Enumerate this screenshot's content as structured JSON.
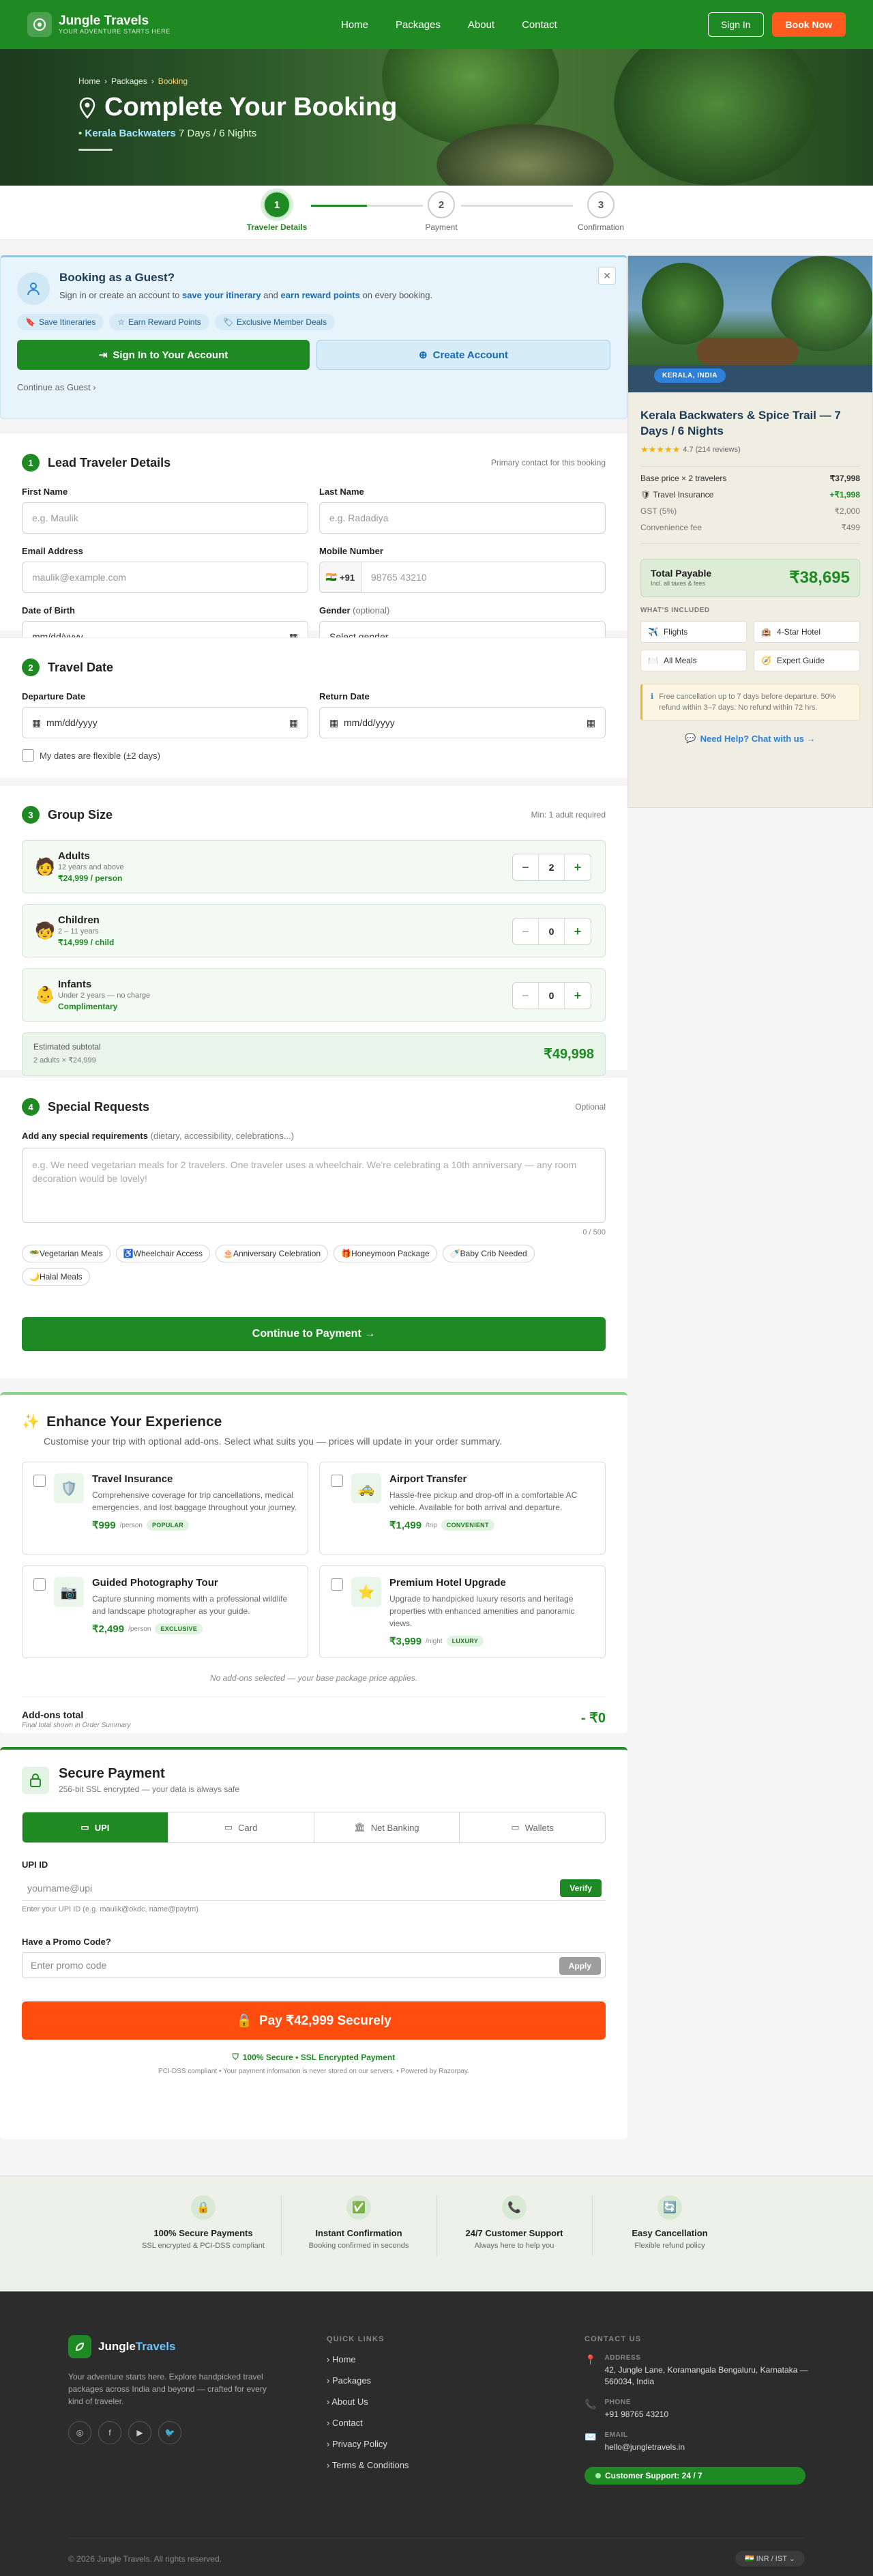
{
  "header": {
    "brand": "Jungle Travels",
    "tagline": "YOUR ADVENTURE STARTS HERE",
    "nav": [
      "Home",
      "Packages",
      "About",
      "Contact"
    ],
    "sign_in": "Sign In",
    "book_now": "Book Now"
  },
  "hero": {
    "crumbs": [
      "Home",
      "›",
      "Packages",
      "›",
      "Booking"
    ],
    "title": "Complete Your Booking",
    "package": "Kerala Backwaters",
    "duration": "7 Days / 6 Nights"
  },
  "steps": [
    {
      "num": "1",
      "label": "Traveler Details"
    },
    {
      "num": "2",
      "label": "Payment"
    },
    {
      "num": "3",
      "label": "Confirmation"
    }
  ],
  "guest": {
    "title": "Booking as a Guest?",
    "desc_a": "Sign in or create an account to",
    "desc_b": "save your itinerary",
    "desc_c": "and",
    "desc_d": "earn reward points",
    "desc_e": "on every booking.",
    "chips": [
      "Save Itineraries",
      "Earn Reward Points",
      "Exclusive Member Deals"
    ],
    "signin": "Sign In to Your Account",
    "create": "Create Account",
    "continue": "Continue as Guest  ›",
    "close": "✕"
  },
  "lead": {
    "num": "1",
    "title": "Lead Traveler Details",
    "note": "Primary contact for this booking",
    "first_label": "First Name",
    "first_ph": "e.g. Maulik",
    "last_label": "Last Name",
    "last_ph": "e.g. Radadiya",
    "email_label": "Email Address",
    "email_ph": "maulik@example.com",
    "mobile_label": "Mobile Number",
    "code": "+91",
    "mobile_ph": "98765 43210",
    "dob_label": "Date of Birth",
    "dob_ph": "mm/dd/yyyy",
    "gender_label": "Gender",
    "gender_opt": "(optional)",
    "gender_value": "Select gender"
  },
  "travel": {
    "num": "2",
    "title": "Travel Date",
    "dep_label": "Departure Date",
    "ret_label": "Return Date",
    "ph": "mm/dd/yyyy",
    "flex": "My dates are flexible (±2 days)"
  },
  "group": {
    "num": "3",
    "title": "Group Size",
    "note": "Min: 1 adult required",
    "rows": [
      {
        "icon": "🧑",
        "name": "Adults",
        "sub": "12 years and above",
        "price": "₹24,999 / person",
        "value": "2"
      },
      {
        "icon": "🧒",
        "name": "Children",
        "sub": "2 – 11 years",
        "price": "₹14,999 / child",
        "value": "0"
      },
      {
        "icon": "👶",
        "name": "Infants",
        "sub": "Under 2 years — no charge",
        "price": "Complimentary",
        "value": "0"
      }
    ],
    "subtotal_label": "Estimated subtotal",
    "subtotal_detail": "2 adults × ₹24,999",
    "subtotal": "₹49,998"
  },
  "special": {
    "num": "4",
    "title": "Special Requests",
    "note": "Optional",
    "label": "Add any special requirements",
    "label_hint": "(dietary, accessibility, celebrations...)",
    "ph": "e.g. We need vegetarian meals for 2 travelers. One traveler uses a wheelchair. We're celebrating a 10th anniversary — any room decoration would be lovely!",
    "count": "0 / 500",
    "tags": [
      "🥗Vegetarian Meals",
      "♿Wheelchair Access",
      "🎂Anniversary Celebration",
      "🎁Honeymoon Package",
      "🍼Baby Crib Needed",
      "🌙Halal Meals"
    ],
    "continue": "Continue to Payment  →"
  },
  "addons": {
    "title": "Enhance Your Experience",
    "desc": "Customise your trip with optional add-ons. Select what suits you — prices will update in your order summary.",
    "items": [
      {
        "icon": "🛡️",
        "name": "Travel Insurance",
        "desc": "Comprehensive coverage for trip cancellations, medical emergencies, and lost baggage throughout your journey.",
        "price": "₹999",
        "unit": "/person",
        "badge": "POPULAR"
      },
      {
        "icon": "🚕",
        "name": "Airport Transfer",
        "desc": "Hassle-free pickup and drop-off in a comfortable AC vehicle. Available for both arrival and departure.",
        "price": "₹1,499",
        "unit": "/trip",
        "badge": "CONVENIENT"
      },
      {
        "icon": "📷",
        "name": "Guided Photography Tour",
        "desc": "Capture stunning moments with a professional wildlife and landscape photographer as your guide.",
        "price": "₹2,499",
        "unit": "/person",
        "badge": "EXCLUSIVE"
      },
      {
        "icon": "⭐",
        "name": "Premium Hotel Upgrade",
        "desc": "Upgrade to handpicked luxury resorts and heritage properties with enhanced amenities and panoramic views.",
        "price": "₹3,999",
        "unit": "/night",
        "badge": "LUXURY"
      }
    ],
    "none": "No add-ons selected — your base package price applies.",
    "total_label": "Add-ons total",
    "total_hint": "Final total shown in Order Summary",
    "total": "- ₹0"
  },
  "payment": {
    "title": "Secure Payment",
    "sub": "256-bit SSL encrypted — your data is always safe",
    "tabs": [
      "UPI",
      "Card",
      "Net Banking",
      "Wallets"
    ],
    "upi_label": "UPI ID",
    "upi_ph": "yourname@upi",
    "verify": "Verify",
    "upi_hint": "Enter your UPI ID (e.g. maulik@okdc, name@paytm)",
    "promo_label": "Have a Promo Code?",
    "promo_ph": "Enter promo code",
    "apply": "Apply",
    "pay": "Pay ₹42,999 Securely",
    "secure": "100% Secure • SSL Encrypted Payment",
    "pci": "PCI-DSS compliant • Your payment information is never stored on our servers. • Powered by Razorpay."
  },
  "summary": {
    "badge": "KERALA, INDIA",
    "title": "Kerala Backwaters & Spice Trail — 7 Days / 6 Nights",
    "rating": "4.7 (214 reviews)",
    "rows": [
      {
        "label": "Base price × 2 travelers",
        "value": "₹37,998"
      },
      {
        "label": "Travel Insurance",
        "value": "+₹1,998"
      },
      {
        "label": "GST (5%)",
        "value": "₹2,000"
      },
      {
        "label": "Convenience fee",
        "value": "₹499"
      }
    ],
    "total_label": "Total Payable",
    "total_hint": "Incl. all taxes & fees",
    "total": "₹38,695",
    "included_title": "WHAT'S INCLUDED",
    "included": [
      {
        "icon": "✈️",
        "label": "Flights"
      },
      {
        "icon": "🏨",
        "label": "4-Star Hotel"
      },
      {
        "icon": "🍽️",
        "label": "All Meals"
      },
      {
        "icon": "🧭",
        "label": "Expert Guide"
      }
    ],
    "cancel": "Free cancellation up to 7 days before departure. 50% refund within 3–7 days. No refund within 72 hrs.",
    "help": "Need Help? Chat with us →"
  },
  "trust": [
    {
      "icon": "🔒",
      "title": "100% Secure Payments",
      "desc": "SSL encrypted & PCI-DSS compliant"
    },
    {
      "icon": "✅",
      "title": "Instant Confirmation",
      "desc": "Booking confirmed in seconds"
    },
    {
      "icon": "📞",
      "title": "24/7 Customer Support",
      "desc": "Always here to help you"
    },
    {
      "icon": "🔄",
      "title": "Easy Cancellation",
      "desc": "Flexible refund policy"
    }
  ],
  "footer": {
    "brand_a": "Jungle",
    "brand_b": "Travels",
    "desc": "Your adventure starts here. Explore handpicked travel packages across India and beyond — crafted for every kind of traveler.",
    "links_title": "QUICK LINKS",
    "links": [
      "Home",
      "Packages",
      "About Us",
      "Contact",
      "Privacy Policy",
      "Terms & Conditions"
    ],
    "contact_title": "CONTACT US",
    "address_label": "ADDRESS",
    "address": "42, Jungle Lane, Koramangala Bengaluru, Karnataka — 560034, India",
    "phone_label": "PHONE",
    "phone": "+91 98765 43210",
    "email_label": "EMAIL",
    "email": "hello@jungletravels.in",
    "support": "Customer Support: 24 / 7",
    "copy": "© 2026 Jungle Travels. All rights reserved.",
    "locale": "🇮🇳 INR / IST  ⌄"
  }
}
